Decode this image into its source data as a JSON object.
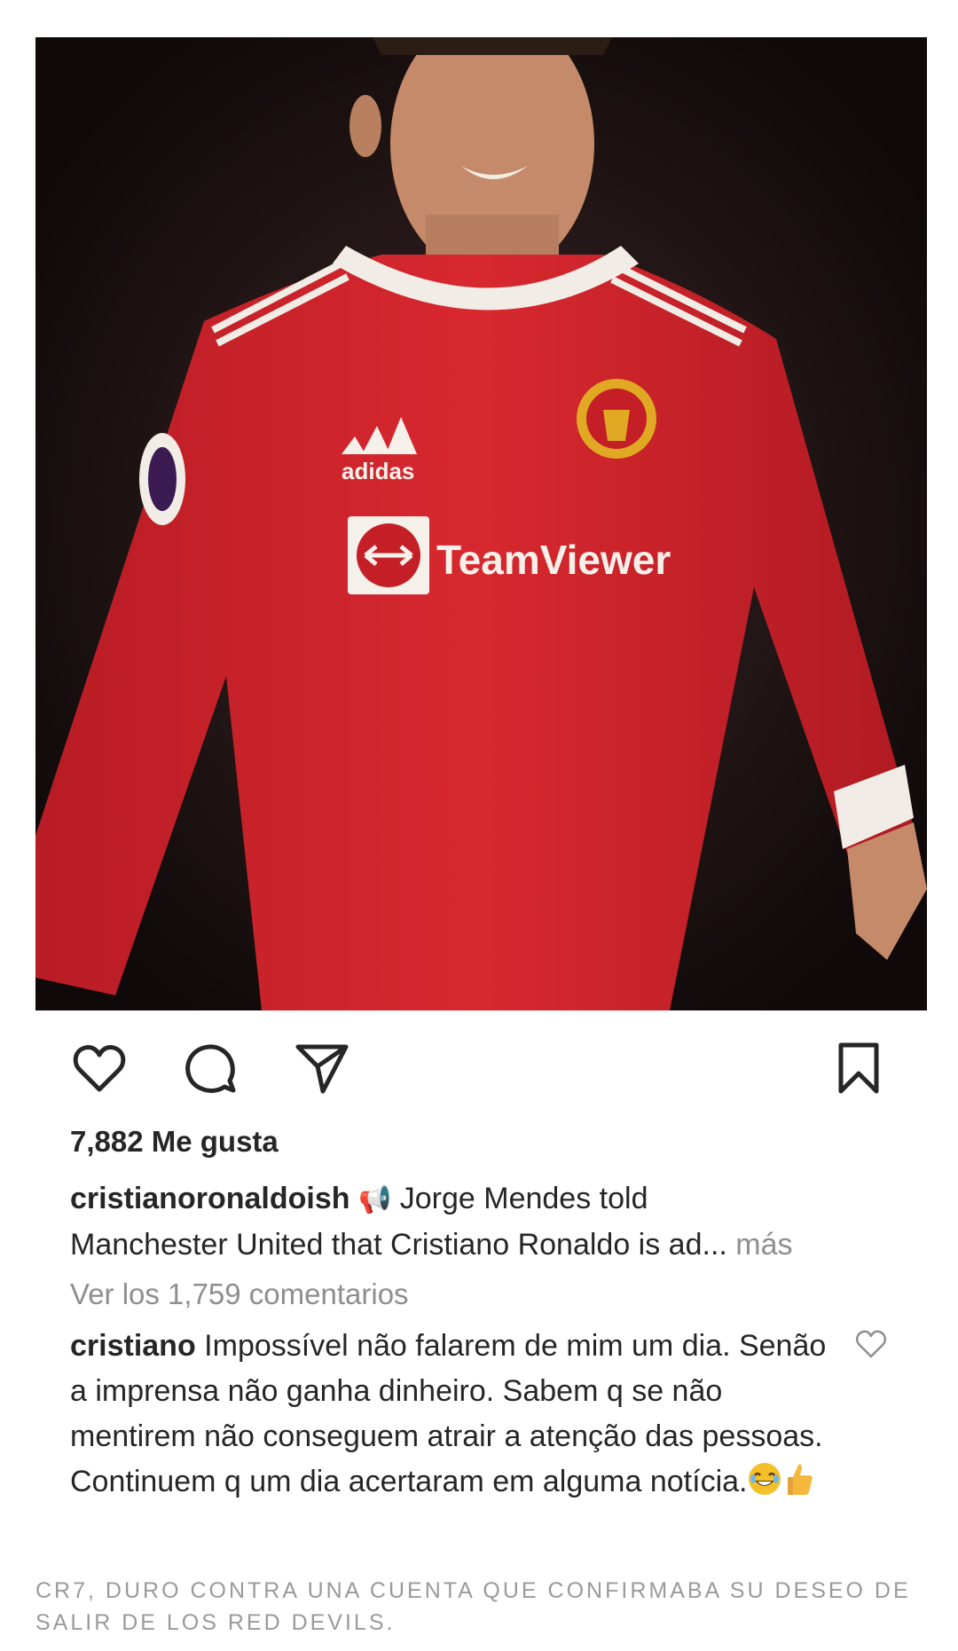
{
  "post": {
    "image": {
      "alt_icons": [
        "adidas-logo",
        "manchester-united-crest",
        "teamviewer-logo",
        "premier-league-badge"
      ],
      "sponsor_text": "TeamViewer",
      "brand_text": "adidas",
      "colors": {
        "shirt": "#d1242c",
        "background": "#1a1212",
        "skin": "#c98f6e"
      }
    },
    "actions": {
      "icons": [
        "heart-icon",
        "comment-icon",
        "share-icon",
        "bookmark-icon"
      ]
    },
    "likes_text": "7,882 Me gusta",
    "caption": {
      "username": "cristianoronaldoish",
      "emoji": "📢",
      "line1": "Jorge Mendes told",
      "line2": "Manchester United that Cristiano Ronaldo is ad",
      "ellipsis": "...",
      "more": "más"
    },
    "view_comments": "Ver los 1,759 comentarios",
    "comment": {
      "username": "cristiano",
      "text": "Impossível não falarem de mim um dia. Senão a imprensa não ganha dinheiro. Sabem q se não mentirem não conseguem atrair a atenção das pessoas. Continuem q um dia acertaram em alguma notícia."
    }
  },
  "footer_caption": "CR7, duro contra una cuenta que confirmaba su deseo de salir de los Red Devils."
}
